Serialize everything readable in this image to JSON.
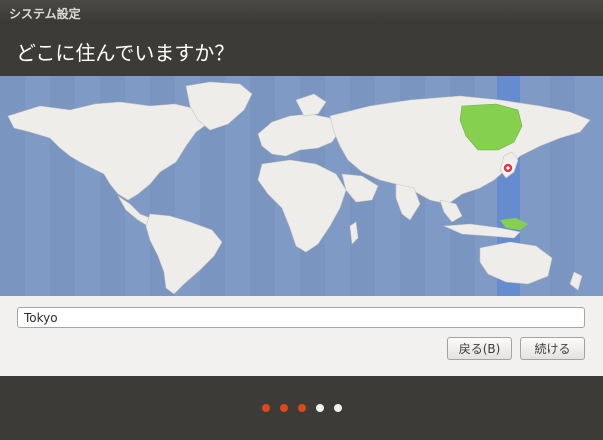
{
  "window": {
    "title": "システム設定"
  },
  "page": {
    "heading": "どこに住んでいますか？"
  },
  "timezone": {
    "value": "Tokyo"
  },
  "buttons": {
    "back": "戻る(B)",
    "next": "続ける"
  },
  "progress": {
    "current_step": 3,
    "total_steps": 5,
    "active_color": "#dd4814",
    "inactive_color": "#f2f1f0"
  },
  "colors": {
    "ocean": "#7f9ac4",
    "land": "#efedea",
    "highlight_zone": "#6a93d4",
    "highlight_land": "#85d14f",
    "marker": "#e0364a"
  }
}
